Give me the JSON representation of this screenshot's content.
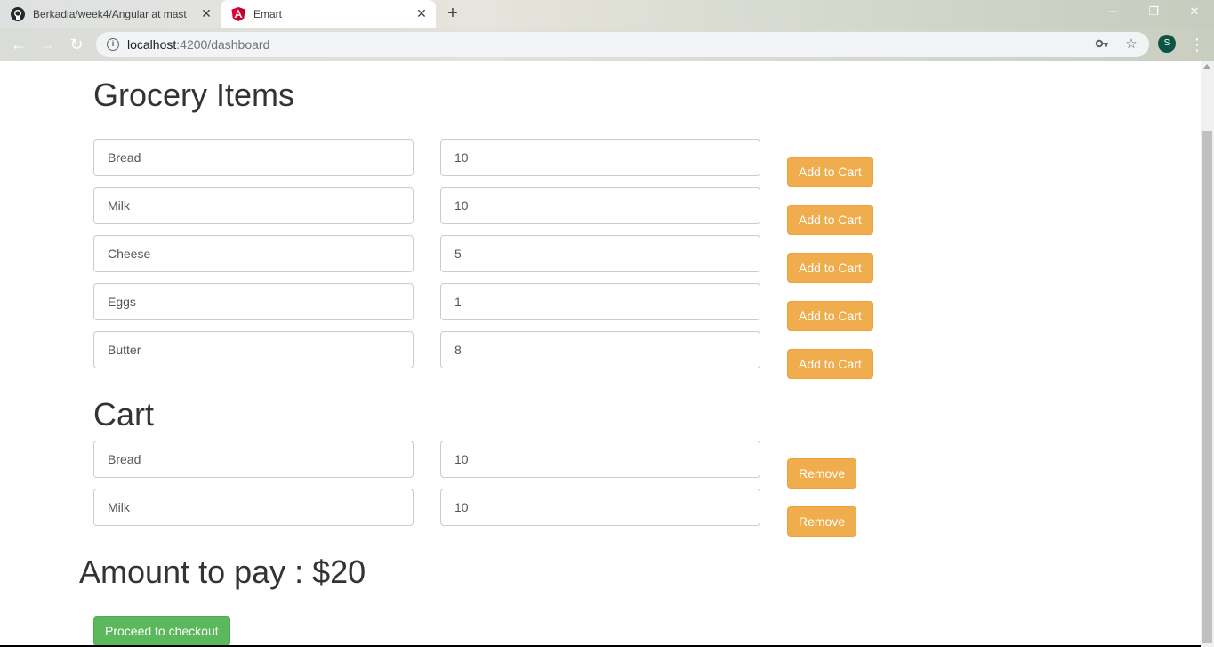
{
  "browser": {
    "tabs": [
      {
        "title": "Berkadia/week4/Angular at mast",
        "icon": "github-icon"
      },
      {
        "title": "Emart",
        "icon": "angular-icon"
      }
    ],
    "url_host": "localhost",
    "url_path": ":4200/dashboard",
    "profile_initial": "S"
  },
  "page": {
    "grocery_title": "Grocery Items",
    "grocery_items": [
      {
        "name": "Bread",
        "qty": "10",
        "button": "Add to Cart"
      },
      {
        "name": "Milk",
        "qty": "10",
        "button": "Add to Cart"
      },
      {
        "name": "Cheese",
        "qty": "5",
        "button": "Add to Cart"
      },
      {
        "name": "Eggs",
        "qty": "1",
        "button": "Add to Cart"
      },
      {
        "name": "Butter",
        "qty": "8",
        "button": "Add to Cart"
      }
    ],
    "cart_title": "Cart",
    "cart_items": [
      {
        "name": "Bread",
        "qty": "10",
        "button": "Remove"
      },
      {
        "name": "Milk",
        "qty": "10",
        "button": "Remove"
      }
    ],
    "amount_label": "Amount to pay : $20",
    "checkout_label": "Proceed to checkout"
  },
  "colors": {
    "warning_button": "#f0ad4e",
    "success_button": "#5cb85c",
    "profile_avatar": "#0b5545"
  }
}
